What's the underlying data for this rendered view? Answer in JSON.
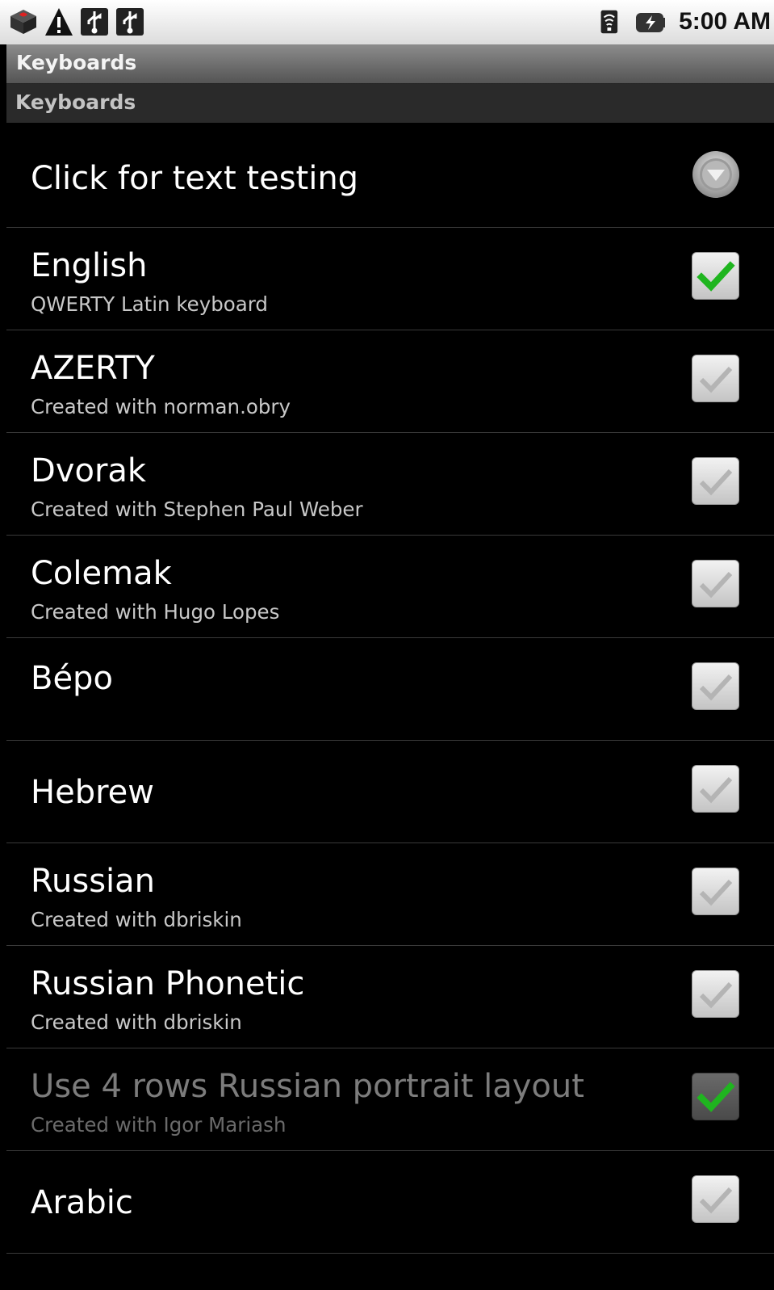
{
  "status_bar": {
    "left_icons": [
      "android-alert-icon",
      "warning-icon",
      "usb-icon",
      "usb-icon"
    ],
    "right_icons": [
      "wifi-icon",
      "battery-icon"
    ],
    "time": "5:00 AM"
  },
  "title_bar": {
    "title": "Keyboards"
  },
  "category": {
    "label": "Keyboards"
  },
  "list": {
    "test_item": {
      "title": "Click for text testing",
      "icon": "dropdown-icon"
    },
    "items": [
      {
        "title": "English",
        "summary": "QWERTY Latin keyboard",
        "checked": true,
        "enabled": true
      },
      {
        "title": "AZERTY",
        "summary": "Created with norman.obry",
        "checked": false,
        "enabled": true
      },
      {
        "title": "Dvorak",
        "summary": "Created with Stephen Paul Weber",
        "checked": false,
        "enabled": true
      },
      {
        "title": "Colemak",
        "summary": "Created with Hugo Lopes",
        "checked": false,
        "enabled": true
      },
      {
        "title": "Bépo",
        "summary": "",
        "checked": false,
        "enabled": true
      },
      {
        "title": "Hebrew",
        "summary": "",
        "checked": false,
        "enabled": true
      },
      {
        "title": "Russian",
        "summary": "Created with dbriskin",
        "checked": false,
        "enabled": true
      },
      {
        "title": "Russian Phonetic",
        "summary": "Created with dbriskin",
        "checked": false,
        "enabled": true
      },
      {
        "title": "Use 4 rows Russian portrait layout",
        "summary": "Created with Igor Mariash",
        "checked": true,
        "enabled": false
      },
      {
        "title": "Arabic",
        "summary": "",
        "checked": false,
        "enabled": true
      }
    ]
  },
  "colors": {
    "background": "#000000",
    "check_active": "#1fb51f",
    "title_bar": "#6e6e6e",
    "category_bar": "#2a2a2a"
  }
}
